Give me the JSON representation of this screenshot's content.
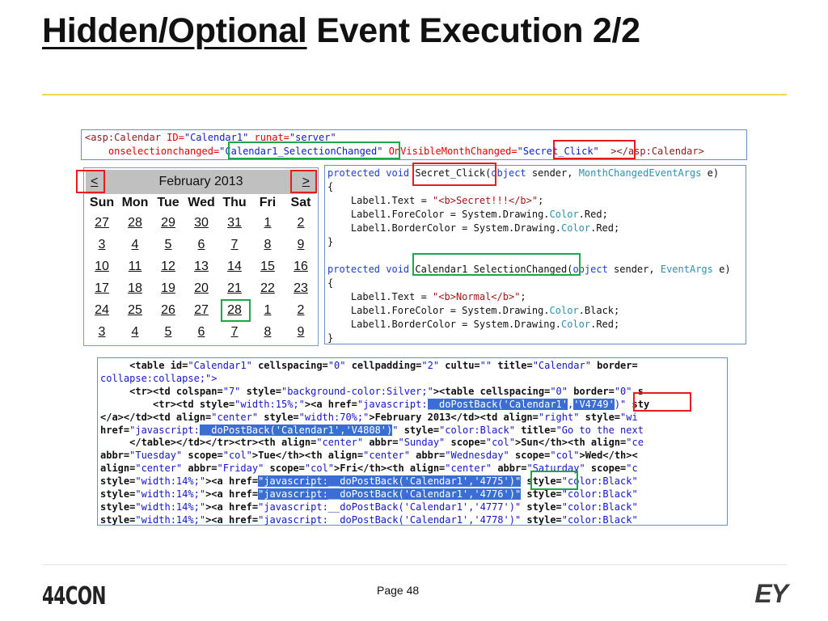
{
  "slide": {
    "title_underlined": "Hidden/Optional",
    "title_rest": " Event Execution 2/2",
    "page_label": "Page 48",
    "logo_left": "44CON",
    "logo_right": "EY"
  },
  "markup_snippet": {
    "t1": "<asp:Calendar ",
    "t2": "ID=",
    "t3": "\"Calendar1\"",
    "t4": " runat=",
    "t5": "\"server\"",
    "t6": "    onselectionchanged=",
    "t7": "\"Calendar1_SelectionChanged\"",
    "t8": " OnVisibleMonthChanged=",
    "t9": "\"Secret_Click\"",
    "t10": "  ></asp:Calendar>"
  },
  "calendar": {
    "prev": "<",
    "next": ">",
    "month_title": "February 2013",
    "days_of_week": [
      "Sun",
      "Mon",
      "Tue",
      "Wed",
      "Thu",
      "Fri",
      "Sat"
    ],
    "weeks": [
      [
        "27",
        "28",
        "29",
        "30",
        "31",
        "1",
        "2"
      ],
      [
        "3",
        "4",
        "5",
        "6",
        "7",
        "8",
        "9"
      ],
      [
        "10",
        "11",
        "12",
        "13",
        "14",
        "15",
        "16"
      ],
      [
        "17",
        "18",
        "19",
        "20",
        "21",
        "22",
        "23"
      ],
      [
        "24",
        "25",
        "26",
        "27",
        "28",
        "1",
        "2"
      ],
      [
        "3",
        "4",
        "5",
        "6",
        "7",
        "8",
        "9"
      ]
    ]
  },
  "code_behind": {
    "protected_void": "protected void ",
    "secret_name": "Secret_Click",
    "paren_open": "(",
    "object_kw": "object",
    "sender": " sender, ",
    "month_args": "MonthChangedEventArgs",
    "e_close": " e)",
    "brace_open": "{",
    "brace_close": "}",
    "label_text": "    Label1.Text = ",
    "secret_str": "\"<b>Secret!!!</b>\"",
    "semicolon": ";",
    "fore_prefix": "    Label1.ForeColor = System.Drawing.",
    "border_prefix": "    Label1.BorderColor = System.Drawing.",
    "color_kw": "Color",
    "red_suffix": ".Red;",
    "black_suffix": ".Black;",
    "selection_name": "Calendar1_SelectionChanged",
    "event_args": "EventArgs",
    "normal_str": "\"<b>Normal</b>\""
  },
  "rendered_html": {
    "l1a": "     <table id=",
    "l1b": "\"Calendar1\"",
    "l1c": " cellspacing=",
    "l1d": "\"0\"",
    "l1e": " cellpadding=",
    "l1f": "\"2\"",
    "l1g": " cultu=",
    "l1h": "\"\"",
    "l1i": " title=",
    "l1j": "\"Calendar\"",
    "l1k": " border=",
    "l2": "collapse:collapse;\">",
    "l3a": "     <tr><td colspan=",
    "l3b": "\"7\"",
    "l3c": " style=",
    "l3d": "\"background-color:Silver;\"",
    "l3e": "><table cellspacing=",
    "l3f": "\"0\"",
    "l3g": " border=",
    "l3h": "\"0\"",
    "l3i": " s",
    "l4a": "         <tr><td style=",
    "l4b": "\"width:15%;\"",
    "l4c": "><a href=",
    "l4d": "\"javascript:",
    "l4e": "__doPostBack('Calendar1'",
    "l4f": ",",
    "l4g": "'V4749'",
    "l4h": ")\"",
    "l4i": " sty",
    "l5a": "</a></td><td align=",
    "l5b": "\"center\"",
    "l5c": " style=",
    "l5d": "\"width:70%;\"",
    "l5e": ">February 2013</td><td align=",
    "l5f": "\"right\"",
    "l5g": " style=",
    "l5h": "\"wi",
    "l6a": "href=",
    "l6b": "\"javascript:",
    "l6c": "__doPostBack('Calendar1','V4808')",
    "l6d": "\"",
    "l6e": " style=",
    "l6f": "\"color:Black\"",
    "l6g": " title=",
    "l6h": "\"Go to the next",
    "l7a": "     </table></td></tr><tr><th align=",
    "l7b": "\"center\"",
    "l7c": " abbr=",
    "l7d": "\"Sunday\"",
    "l7e": " scope=",
    "l7f": "\"col\"",
    "l7g": ">Sun</th><th align=",
    "l7h": "\"ce",
    "l8a": "abbr=",
    "l8b": "\"Tuesday\"",
    "l8c": " scope=",
    "l8d": "\"col\"",
    "l8e": ">Tue</th><th align=",
    "l8f": "\"center\"",
    "l8g": " abbr=",
    "l8h": "\"Wednesday\"",
    "l8i": " scope=",
    "l8j": "\"col\"",
    "l8k": ">Wed</th><",
    "l9a": "align=",
    "l9b": "\"center\"",
    "l9c": " abbr=",
    "l9d": "\"Friday\"",
    "l9e": " scope=",
    "l9f": "\"col\"",
    "l9g": ">Fri</th><th align=",
    "l9h": "\"center\"",
    "l9i": " abbr=",
    "l9j": "\"Saturday\"",
    "l9k": " scope=",
    "l9l": "\"c",
    "r1a": "style=",
    "r1b": "\"width:14%;\"",
    "r1c": "><a href=",
    "r1d": "\"javascript:__doPostBack('Calendar1','4775')\"",
    "r1e": " style=",
    "r1f": "\"color:Black\"",
    "r2d": "\"javascript:__doPostBack('Calendar1','4776')\"",
    "r3d": "\"javascript:__doPostBack('Calendar1','4777')\"",
    "r4d": "\"javascript:__doPostBack('Calendar1','4778')\""
  },
  "colors": {
    "accent_rule": "#f3d84b",
    "highlight_red": "#e81c1c",
    "highlight_green": "#1aa84a",
    "selection_blue": "#3b6ed2",
    "calendar_header": "#c0c0c0"
  }
}
